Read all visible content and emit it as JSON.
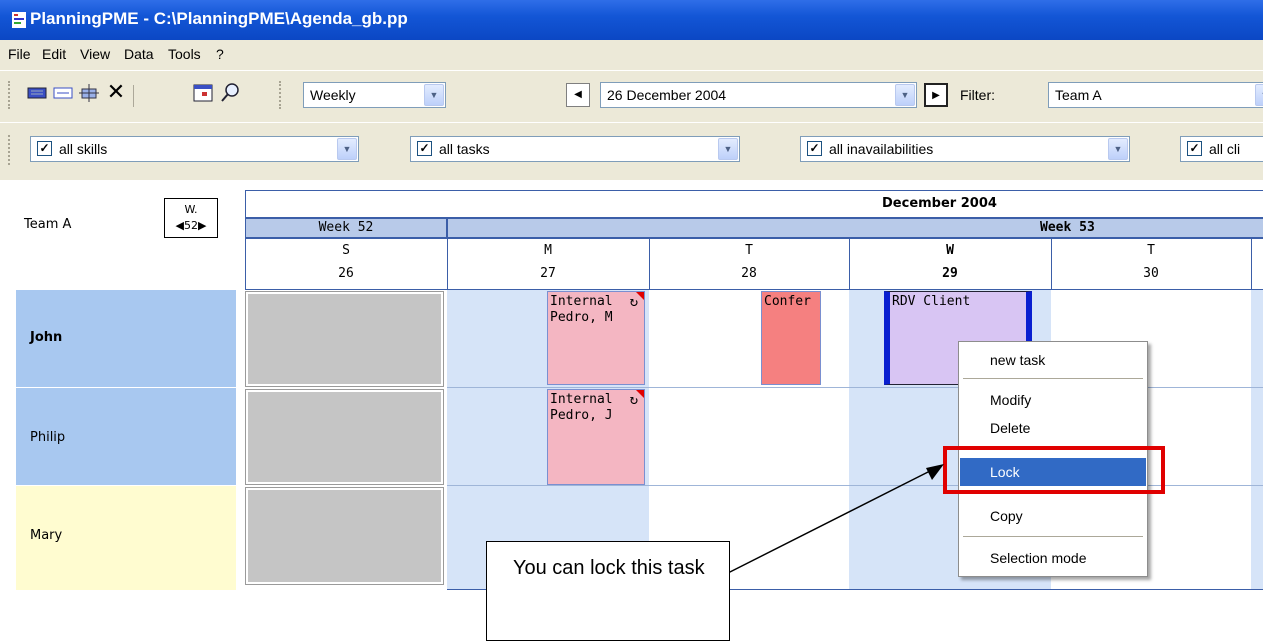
{
  "window": {
    "title": "PlanningPME - C:\\PlanningPME\\Agenda_gb.pp"
  },
  "menu": [
    "File",
    "Edit",
    "View",
    "Data",
    "Tools",
    "?"
  ],
  "toolbar": {
    "icons": [
      "planning-view-icon",
      "outline-view-icon",
      "workload-view-icon",
      "close-icon",
      "calendar-window-icon",
      "search-icon"
    ],
    "view_mode": "Weekly",
    "date": "26 December 2004",
    "filter_label": "Filter:",
    "filter_value": "Team A"
  },
  "filters": {
    "skills": "all skills",
    "tasks": "all tasks",
    "inavailabilities": "all inavailabilities",
    "clients": "all cli"
  },
  "planning": {
    "team_label": "Team A",
    "week_nav": {
      "label": "W.",
      "value": "52"
    },
    "month_title": "December 2004",
    "weeks": [
      "Week 52",
      "Week 53"
    ],
    "days": [
      {
        "letter": "S",
        "num": "26",
        "bold": false
      },
      {
        "letter": "M",
        "num": "27",
        "bold": false
      },
      {
        "letter": "T",
        "num": "28",
        "bold": false
      },
      {
        "letter": "W",
        "num": "29",
        "bold": true
      },
      {
        "letter": "T",
        "num": "30",
        "bold": false
      }
    ],
    "resources": [
      "John",
      "Philip",
      "Mary"
    ],
    "tasks": [
      {
        "text": "Internal\nPedro, M",
        "color": "#f4b6c2"
      },
      {
        "text": "Confer",
        "color": "#f58080"
      },
      {
        "text": "RDV Client",
        "color": "#d8c5f3"
      },
      {
        "text": "Internal\nPedro, J",
        "color": "#f4b6c2"
      }
    ]
  },
  "context_menu": {
    "items": [
      "new task",
      "Modify",
      "Delete",
      "Lock",
      "Copy",
      "Selection mode"
    ],
    "selected": "Lock"
  },
  "callout": {
    "text": "You can lock this task"
  },
  "colors": {
    "titlebar": "#0b47c4",
    "row_john": "#a8c8f0",
    "row_mary": "#fffcd0",
    "weekend": "#c5c5c5",
    "selected_menu": "#316ac5",
    "highlight": "#e00000"
  }
}
